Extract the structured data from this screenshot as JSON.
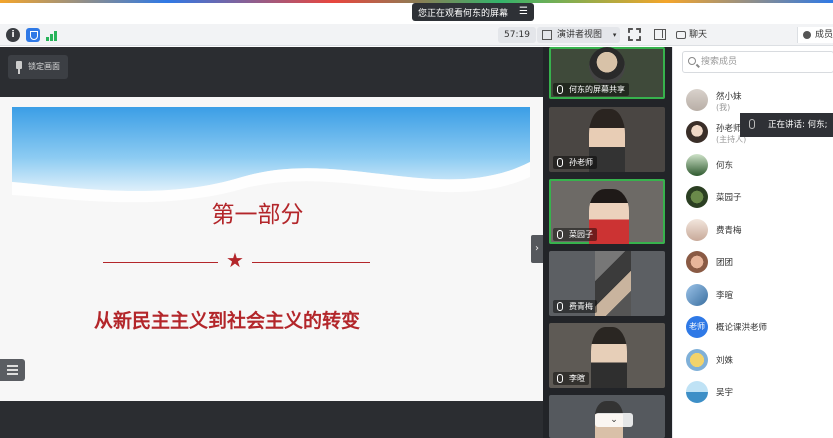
{
  "notice": {
    "text": "您正在观看何东的屏幕"
  },
  "toolbar": {
    "timer": "57:19",
    "view_label": "演讲者视图",
    "chat_label": "聊天",
    "members_label": "成员"
  },
  "share": {
    "lock_label": "锁定画面",
    "slide": {
      "title": "第一部分",
      "subtitle": "从新民主主义到社会主义的转变"
    }
  },
  "videos": [
    {
      "label": "何东的屏幕共享"
    },
    {
      "label": "孙老师"
    },
    {
      "label": "菜园子"
    },
    {
      "label": "费青梅"
    },
    {
      "label": "李暄"
    }
  ],
  "members": {
    "search_placeholder": "搜索成员",
    "speaking": "正在讲话: 何东;",
    "list": [
      {
        "name": "然小妹",
        "role": "(我)"
      },
      {
        "name": "孙老师",
        "role": "(主持人)"
      },
      {
        "name": "何东"
      },
      {
        "name": "菜园子"
      },
      {
        "name": "费青梅"
      },
      {
        "name": "团团"
      },
      {
        "name": "李暄"
      },
      {
        "name": "概论课洪老师",
        "avatar_text": "老师"
      },
      {
        "name": "刘姝"
      },
      {
        "name": "吴宇"
      }
    ]
  },
  "colors": {
    "accent": "#2f79e6",
    "slide_red": "#b3262a",
    "active_green": "#37b24d"
  }
}
